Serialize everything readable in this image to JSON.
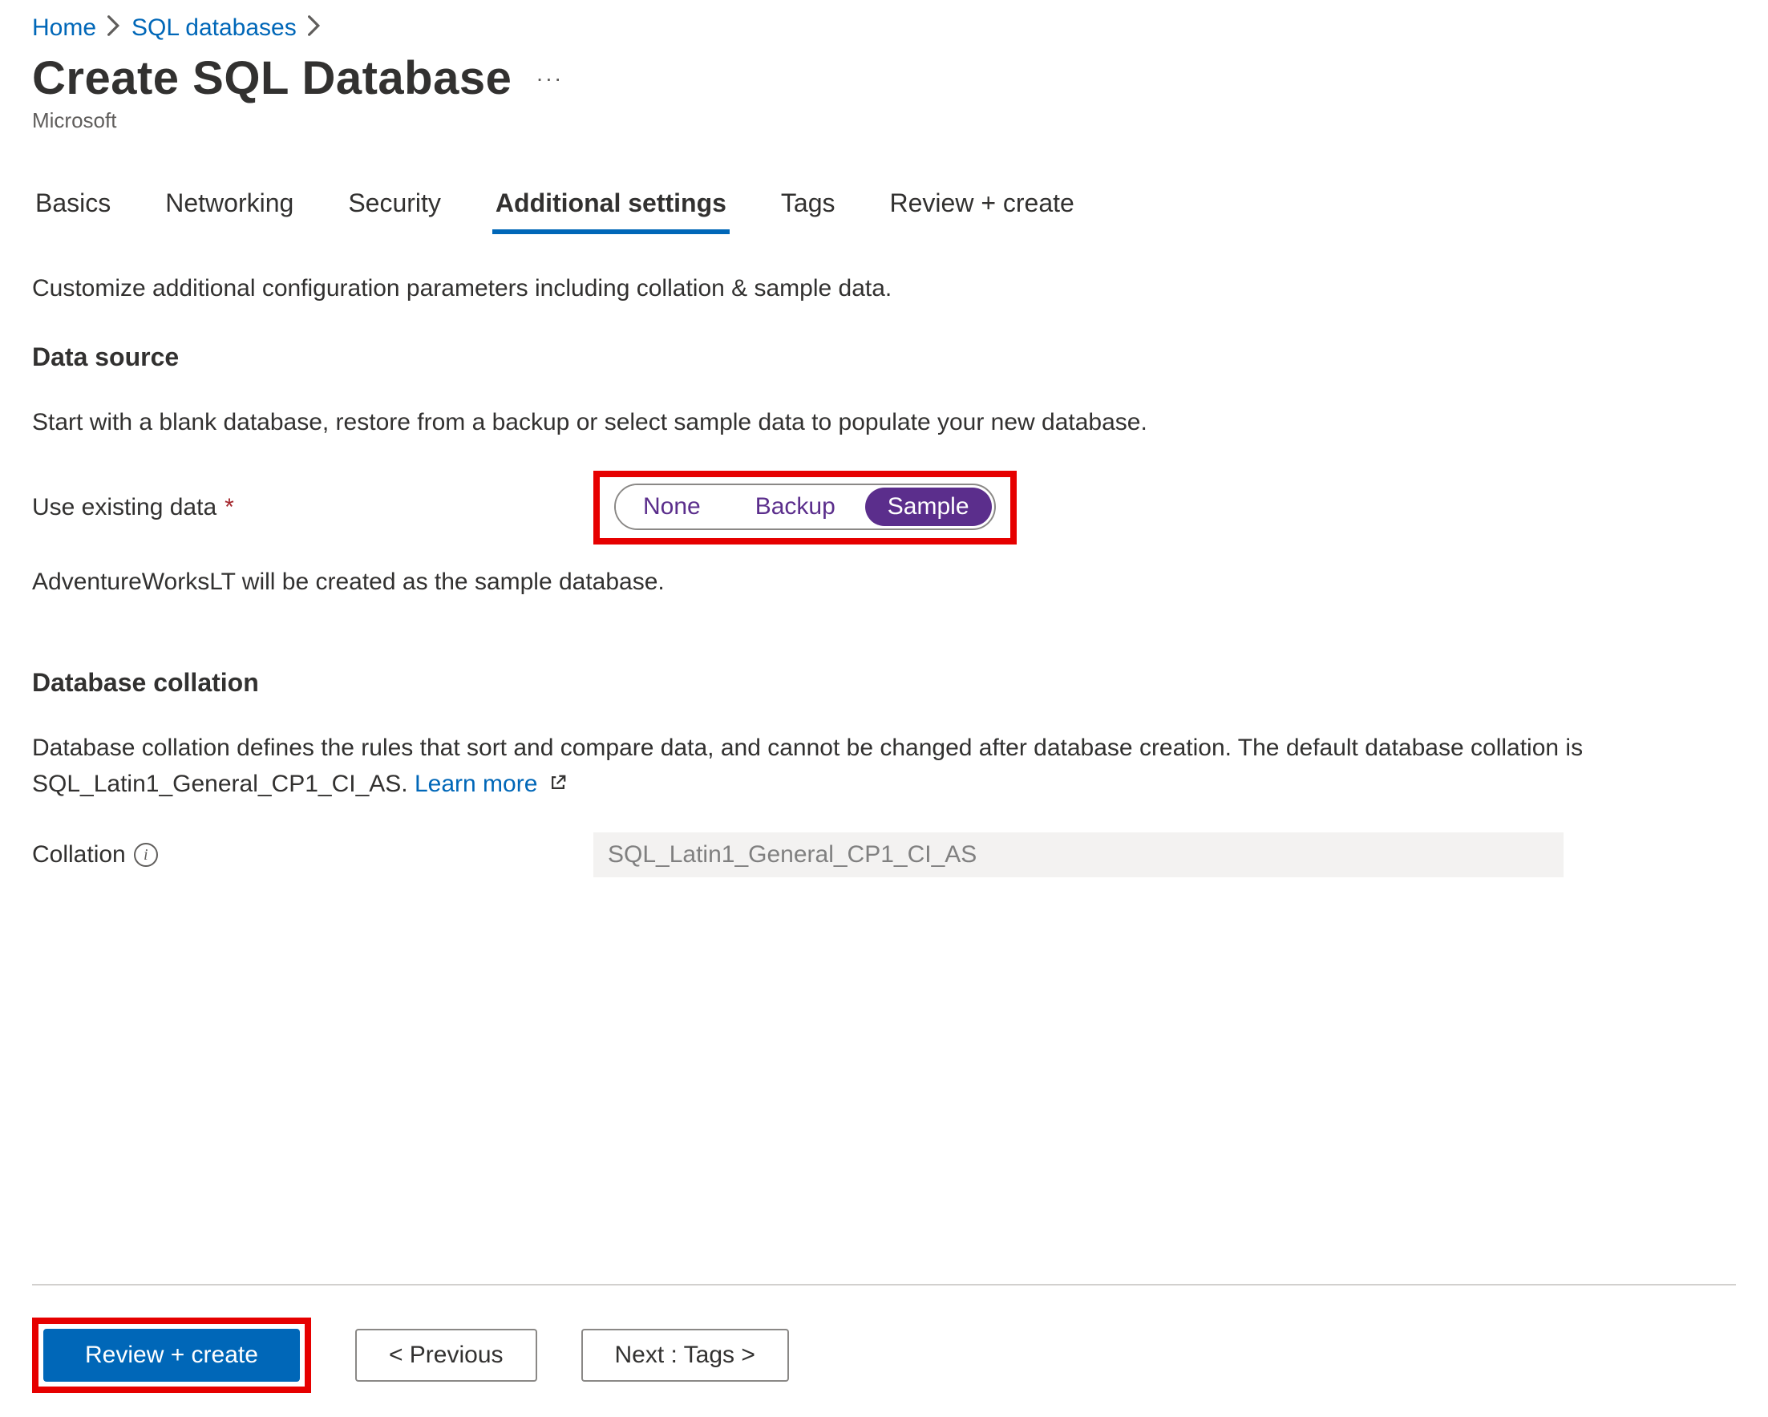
{
  "breadcrumb": {
    "items": [
      "Home",
      "SQL databases"
    ]
  },
  "page": {
    "title": "Create SQL Database",
    "subtitle": "Microsoft"
  },
  "tabs": {
    "items": [
      {
        "label": "Basics",
        "active": false
      },
      {
        "label": "Networking",
        "active": false
      },
      {
        "label": "Security",
        "active": false
      },
      {
        "label": "Additional settings",
        "active": true
      },
      {
        "label": "Tags",
        "active": false
      },
      {
        "label": "Review + create",
        "active": false
      }
    ]
  },
  "main": {
    "intro": "Customize additional configuration parameters including collation & sample data.",
    "data_source": {
      "heading": "Data source",
      "description": "Start with a blank database, restore from a backup or select sample data to populate your new database.",
      "field_label": "Use existing data",
      "required": true,
      "options": [
        {
          "label": "None",
          "selected": false
        },
        {
          "label": "Backup",
          "selected": false
        },
        {
          "label": "Sample",
          "selected": true
        }
      ],
      "hint": "AdventureWorksLT will be created as the sample database."
    },
    "collation": {
      "heading": "Database collation",
      "description_a": "Database collation defines the rules that sort and compare data, and cannot be changed after database creation. The default database collation is SQL_Latin1_General_CP1_CI_AS. ",
      "learn_more": "Learn more",
      "field_label": "Collation",
      "value": "SQL_Latin1_General_CP1_CI_AS"
    }
  },
  "footer": {
    "review_create": "Review + create",
    "previous": "< Previous",
    "next": "Next : Tags >"
  }
}
